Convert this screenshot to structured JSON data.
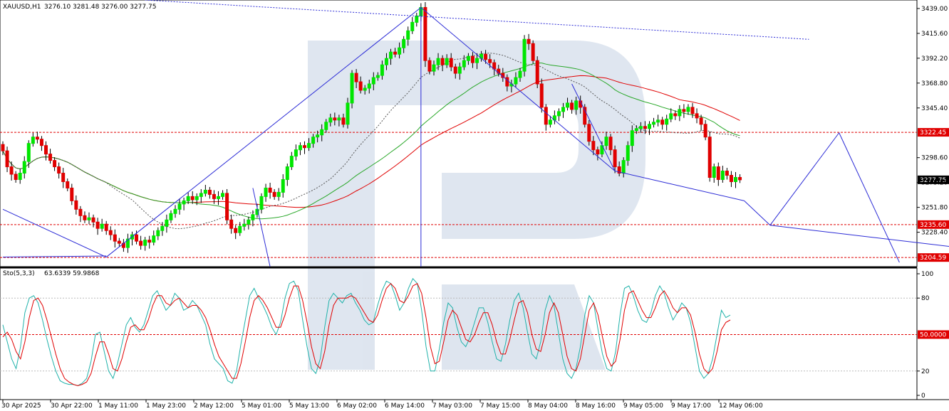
{
  "header": {
    "symbol": "XAUUSD,H1",
    "ohlc": "3276.10 3281.48 3276.00 3277.75"
  },
  "colors": {
    "bull": "#00e600",
    "bear": "#e00000",
    "trendline": "#2b2bd6",
    "ma_red": "#e00000",
    "ma_green": "#2aa82a",
    "ma_dashed": "#555555",
    "level_line": "#e00000",
    "watermark": "#dbe3ee",
    "stoch_main": "#20b2aa",
    "stoch_signal": "#e00000"
  },
  "chart_data": [
    {
      "type": "candlestick",
      "symbol": "XAUUSD",
      "timeframe": "H1",
      "last_ohlc": {
        "open": 3276.1,
        "high": 3281.48,
        "low": 3276.0,
        "close": 3277.75
      },
      "ylim": [
        3196,
        3447
      ],
      "y_ticks": [
        "3439.00",
        "3415.60",
        "3392.20",
        "3368.80",
        "3345.40",
        "3298.60",
        "3275.20",
        "3251.80",
        "3228.40"
      ],
      "x_ticks": [
        "30 Apr 2025",
        "30 Apr 22:00",
        "1 May 11:00",
        "1 May 23:00",
        "2 May 12:00",
        "5 May 01:00",
        "5 May 13:00",
        "6 May 02:00",
        "6 May 14:00",
        "7 May 03:00",
        "7 May 15:00",
        "8 May 04:00",
        "8 May 16:00",
        "9 May 05:00",
        "9 May 17:00",
        "12 May 06:00"
      ],
      "levels": [
        {
          "label": "3322.45",
          "value": 3322.45
        },
        {
          "label": "3235.60",
          "value": 3235.6
        },
        {
          "label": "3204.59",
          "value": 3204.59
        }
      ],
      "current_price": {
        "label": "3277.75",
        "value": 3277.75
      },
      "series": [
        {
          "kind": "candles",
          "close": [
            3305,
            3290,
            3283,
            3278,
            3284,
            3295,
            3312,
            3318,
            3316,
            3310,
            3302,
            3296,
            3290,
            3284,
            3276,
            3270,
            3258,
            3250,
            3244,
            3240,
            3242,
            3238,
            3232,
            3236,
            3230,
            3226,
            3220,
            3218,
            3214,
            3222,
            3226,
            3220,
            3216,
            3221,
            3219,
            3225,
            3230,
            3234,
            3240,
            3246,
            3250,
            3255,
            3258,
            3262,
            3259,
            3262,
            3265,
            3268,
            3264,
            3260,
            3262,
            3265,
            3240,
            3232,
            3228,
            3234,
            3236,
            3240,
            3245,
            3250,
            3262,
            3270,
            3266,
            3262,
            3266,
            3278,
            3290,
            3300,
            3306,
            3310,
            3308,
            3312,
            3318,
            3320,
            3325,
            3332,
            3336,
            3334,
            3336,
            3330,
            3350,
            3378,
            3370,
            3362,
            3364,
            3368,
            3374,
            3376,
            3386,
            3392,
            3398,
            3396,
            3402,
            3410,
            3418,
            3426,
            3432,
            3440,
            3390,
            3380,
            3386,
            3392,
            3386,
            3392,
            3384,
            3378,
            3384,
            3390,
            3394,
            3388,
            3392,
            3396,
            3391,
            3388,
            3382,
            3378,
            3374,
            3366,
            3368,
            3374,
            3380,
            3410,
            3406,
            3390,
            3368,
            3346,
            3330,
            3334,
            3338,
            3342,
            3346,
            3350,
            3344,
            3352,
            3346,
            3330,
            3314,
            3306,
            3302,
            3310,
            3318,
            3306,
            3290,
            3284,
            3296,
            3310,
            3324,
            3326,
            3328,
            3326,
            3330,
            3332,
            3334,
            3330,
            3335,
            3340,
            3338,
            3344,
            3342,
            3346,
            3340,
            3336,
            3330,
            3318,
            3280,
            3290,
            3278,
            3286,
            3282,
            3276,
            3280,
            3277.75
          ]
        },
        {
          "kind": "ma_red"
        },
        {
          "kind": "ma_green"
        },
        {
          "kind": "ma_dashed"
        }
      ]
    },
    {
      "type": "line",
      "name": "Sto(5,3,3)",
      "legend_values": "63.6339 59.9868",
      "ylim": [
        0,
        100
      ],
      "y_ticks": [
        "100",
        "80",
        "20",
        "0"
      ],
      "level": {
        "label": "50.0000",
        "value": 50
      },
      "series": [
        {
          "kind": "main",
          "values": [
            58,
            44,
            30,
            22,
            40,
            68,
            80,
            82,
            76,
            62,
            46,
            32,
            20,
            12,
            10,
            9,
            9,
            8,
            10,
            14,
            28,
            50,
            52,
            36,
            20,
            14,
            26,
            42,
            58,
            64,
            56,
            52,
            58,
            70,
            82,
            86,
            78,
            70,
            74,
            84,
            80,
            70,
            72,
            78,
            74,
            66,
            58,
            42,
            30,
            26,
            22,
            12,
            10,
            20,
            42,
            62,
            82,
            88,
            80,
            74,
            66,
            56,
            50,
            60,
            80,
            92,
            94,
            86,
            62,
            40,
            22,
            18,
            30,
            56,
            78,
            84,
            80,
            76,
            82,
            84,
            76,
            70,
            62,
            58,
            60,
            74,
            86,
            94,
            92,
            82,
            70,
            76,
            88,
            96,
            92,
            70,
            40,
            20,
            20,
            38,
            60,
            76,
            72,
            56,
            44,
            40,
            48,
            60,
            72,
            72,
            60,
            44,
            30,
            28,
            42,
            62,
            78,
            84,
            72,
            52,
            34,
            30,
            44,
            70,
            82,
            74,
            52,
            30,
            18,
            14,
            22,
            40,
            66,
            82,
            76,
            54,
            34,
            22,
            20,
            36,
            66,
            88,
            90,
            82,
            70,
            62,
            60,
            68,
            82,
            90,
            84,
            72,
            62,
            68,
            76,
            72,
            60,
            40,
            20,
            14,
            18,
            30,
            50,
            70,
            64,
            66
          ]
        },
        {
          "kind": "signal",
          "values": [
            48,
            52,
            46,
            36,
            30,
            44,
            64,
            78,
            80,
            74,
            62,
            48,
            34,
            22,
            14,
            11,
            9,
            8,
            9,
            11,
            18,
            32,
            44,
            44,
            34,
            22,
            20,
            30,
            44,
            56,
            58,
            54,
            54,
            62,
            74,
            82,
            82,
            76,
            74,
            78,
            80,
            76,
            72,
            74,
            74,
            70,
            64,
            54,
            42,
            32,
            26,
            20,
            14,
            14,
            26,
            44,
            64,
            78,
            82,
            78,
            72,
            64,
            56,
            56,
            66,
            80,
            90,
            90,
            78,
            60,
            40,
            26,
            22,
            36,
            58,
            74,
            80,
            80,
            80,
            82,
            80,
            74,
            68,
            62,
            60,
            66,
            78,
            88,
            92,
            88,
            78,
            76,
            82,
            90,
            92,
            84,
            64,
            40,
            26,
            28,
            44,
            62,
            70,
            66,
            56,
            46,
            44,
            50,
            60,
            68,
            68,
            58,
            44,
            34,
            34,
            46,
            62,
            76,
            78,
            68,
            50,
            38,
            36,
            50,
            68,
            76,
            68,
            50,
            32,
            22,
            20,
            30,
            50,
            70,
            76,
            66,
            48,
            32,
            24,
            28,
            46,
            70,
            84,
            86,
            78,
            70,
            64,
            64,
            72,
            82,
            86,
            80,
            72,
            68,
            72,
            72,
            66,
            52,
            34,
            22,
            18,
            22,
            36,
            54,
            60,
            62
          ]
        }
      ]
    }
  ]
}
